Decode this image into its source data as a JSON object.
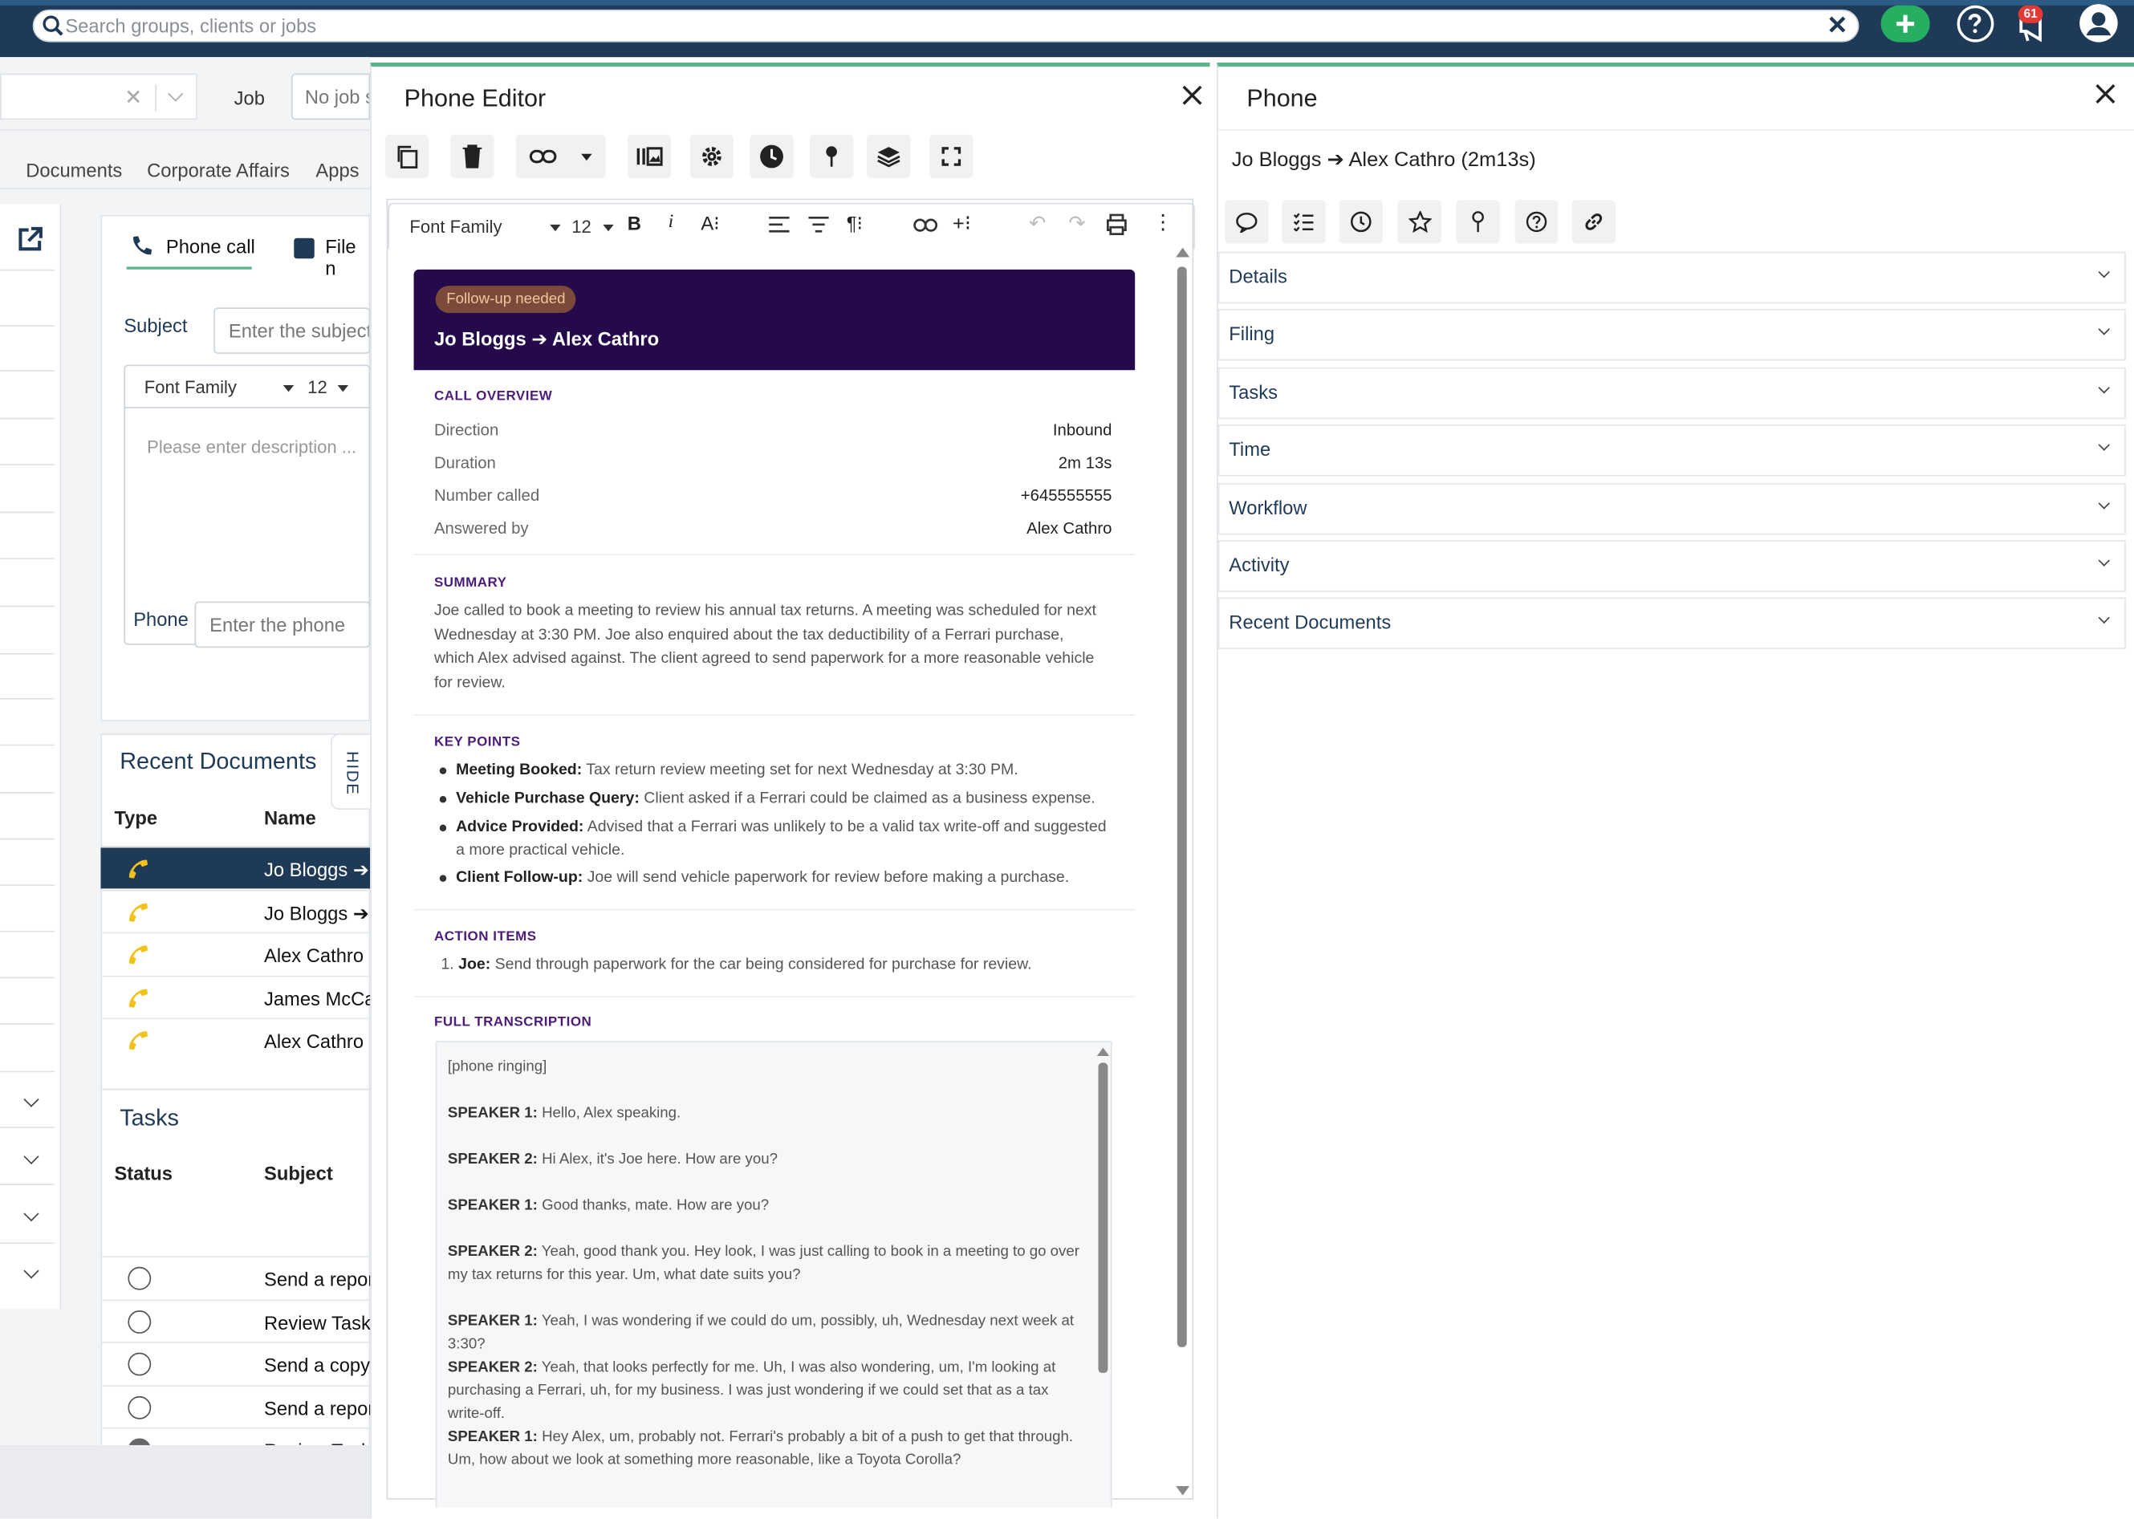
{
  "topbar": {
    "search_placeholder": "Search groups, clients or jobs",
    "notification_count": "61"
  },
  "background": {
    "job_label": "Job",
    "job_value": "No job s",
    "tabs": [
      "Documents",
      "Corporate Affairs",
      "Apps"
    ],
    "phone_call_tab": "Phone call",
    "file_tab": "File n",
    "subject_label": "Subject",
    "subject_placeholder": "Enter the subject",
    "font_family": "Font Family",
    "font_size": "12",
    "description_placeholder": "Please enter description ...",
    "phone_label": "Phone",
    "phone_placeholder": "Enter the phone",
    "recent_documents_title": "Recent Documents",
    "hide_label": "HIDE",
    "recent_cols": [
      "Type",
      "Name"
    ],
    "recent_rows": [
      "Jo Bloggs ➔",
      "Jo Bloggs ➔",
      "Alex Cathro ·",
      "James McCar",
      "Alex Cathro ·"
    ],
    "tasks_title": "Tasks",
    "task_cols": [
      "Status",
      "Subject"
    ],
    "task_rows": [
      "Send a repor",
      "Review Tasks",
      "Send a copy",
      "Send a repor",
      "Review Tasks"
    ]
  },
  "editor": {
    "title": "Phone Editor",
    "font_family": "Font Family",
    "font_size": "12",
    "doc": {
      "badge": "Follow-up needed",
      "heading": "Jo Bloggs ➔ Alex Cathro",
      "overview_title": "CALL OVERVIEW",
      "overview": [
        {
          "k": "Direction",
          "v": "Inbound"
        },
        {
          "k": "Duration",
          "v": "2m 13s"
        },
        {
          "k": "Number called",
          "v": "+645555555"
        },
        {
          "k": "Answered by",
          "v": "Alex Cathro"
        }
      ],
      "summary_title": "SUMMARY",
      "summary": "Joe called to book a meeting to review his annual tax returns. A meeting was scheduled for next Wednesday at 3:30 PM. Joe also enquired about the tax deductibility of a Ferrari purchase, which Alex advised against. The client agreed to send paperwork for a more reasonable vehicle for review.",
      "key_points_title": "KEY POINTS",
      "key_points": [
        {
          "b": "Meeting Booked:",
          "t": " Tax return review meeting set for next Wednesday at 3:30 PM."
        },
        {
          "b": "Vehicle Purchase Query:",
          "t": " Client asked if a Ferrari could be claimed as a business expense."
        },
        {
          "b": "Advice Provided:",
          "t": " Advised that a Ferrari was unlikely to be a valid tax write-off and suggested a more practical vehicle."
        },
        {
          "b": "Client Follow-up:",
          "t": " Joe will send vehicle paperwork for review before making a purchase."
        }
      ],
      "action_items_title": "ACTION ITEMS",
      "action_item_num": "1.",
      "action_item_b": "Joe:",
      "action_item_t": " Send through paperwork for the car being considered for purchase for review.",
      "transcription_title": "FULL TRANSCRIPTION",
      "transcription": [
        {
          "s": "",
          "t": "[phone ringing]"
        },
        {
          "s": "SPEAKER 1:",
          "t": " Hello, Alex speaking."
        },
        {
          "s": "SPEAKER 2:",
          "t": " Hi Alex, it's Joe here. How are you?"
        },
        {
          "s": "SPEAKER 1:",
          "t": " Good thanks, mate. How are you?"
        },
        {
          "s": "SPEAKER 2:",
          "t": " Yeah, good thank you. Hey look, I was just calling to book in a meeting to go over my tax returns for this year. Um, what date suits you?"
        },
        {
          "s": "SPEAKER 1:",
          "t": " Yeah, I was wondering if we could do um, possibly, uh, Wednesday next week at 3:30?"
        },
        {
          "s": "SPEAKER 2:",
          "t": " Yeah, that looks perfectly for me. Uh, I was also wondering, um, I'm looking at purchasing a Ferrari, uh, for my business. I was just wondering if we could set that as a tax write-off."
        },
        {
          "s": "SPEAKER 1:",
          "t": " Hey Alex, um, probably not. Ferrari's probably a bit of a push to get that through. Um, how about we look at something more reasonable, like a Toyota Corolla?"
        }
      ]
    }
  },
  "phone_panel": {
    "title": "Phone",
    "call_title": "Jo Bloggs ➔ Alex Cathro (2m13s)",
    "sections": [
      "Details",
      "Filing",
      "Tasks",
      "Time",
      "Workflow",
      "Activity",
      "Recent Documents"
    ]
  },
  "colors": {
    "accent_green": "#5fb58a",
    "navy": "#1f3a57",
    "doc_header": "#240a4a",
    "phone_icon": "#f2c21b"
  }
}
